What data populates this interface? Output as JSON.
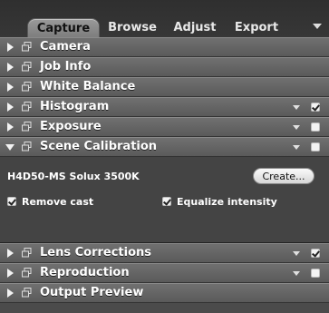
{
  "tabs": [
    {
      "label": "Capture",
      "active": true
    },
    {
      "label": "Browse",
      "active": false
    },
    {
      "label": "Adjust",
      "active": false
    },
    {
      "label": "Export",
      "active": false
    }
  ],
  "panels": [
    {
      "label": "Camera",
      "expanded": false
    },
    {
      "label": "Job Info",
      "expanded": false
    },
    {
      "label": "White Balance",
      "expanded": false
    },
    {
      "label": "Histogram",
      "expanded": false,
      "has_menu": true,
      "enabled": true
    },
    {
      "label": "Exposure",
      "expanded": false,
      "has_menu": true,
      "enabled": false
    },
    {
      "label": "Scene Calibration",
      "expanded": true,
      "has_menu": true,
      "enabled": false
    },
    {
      "label": "Lens Corrections",
      "expanded": false,
      "has_menu": true,
      "enabled": true
    },
    {
      "label": "Reproduction",
      "expanded": false,
      "has_menu": true,
      "enabled": false
    },
    {
      "label": "Output Preview",
      "expanded": false
    }
  ],
  "scene_calibration": {
    "profile_name": "H4D50-MS Solux 3500K",
    "create_button": "Create...",
    "remove_cast_label": "Remove cast",
    "remove_cast_checked": true,
    "equalize_label": "Equalize intensity",
    "equalize_checked": true
  }
}
